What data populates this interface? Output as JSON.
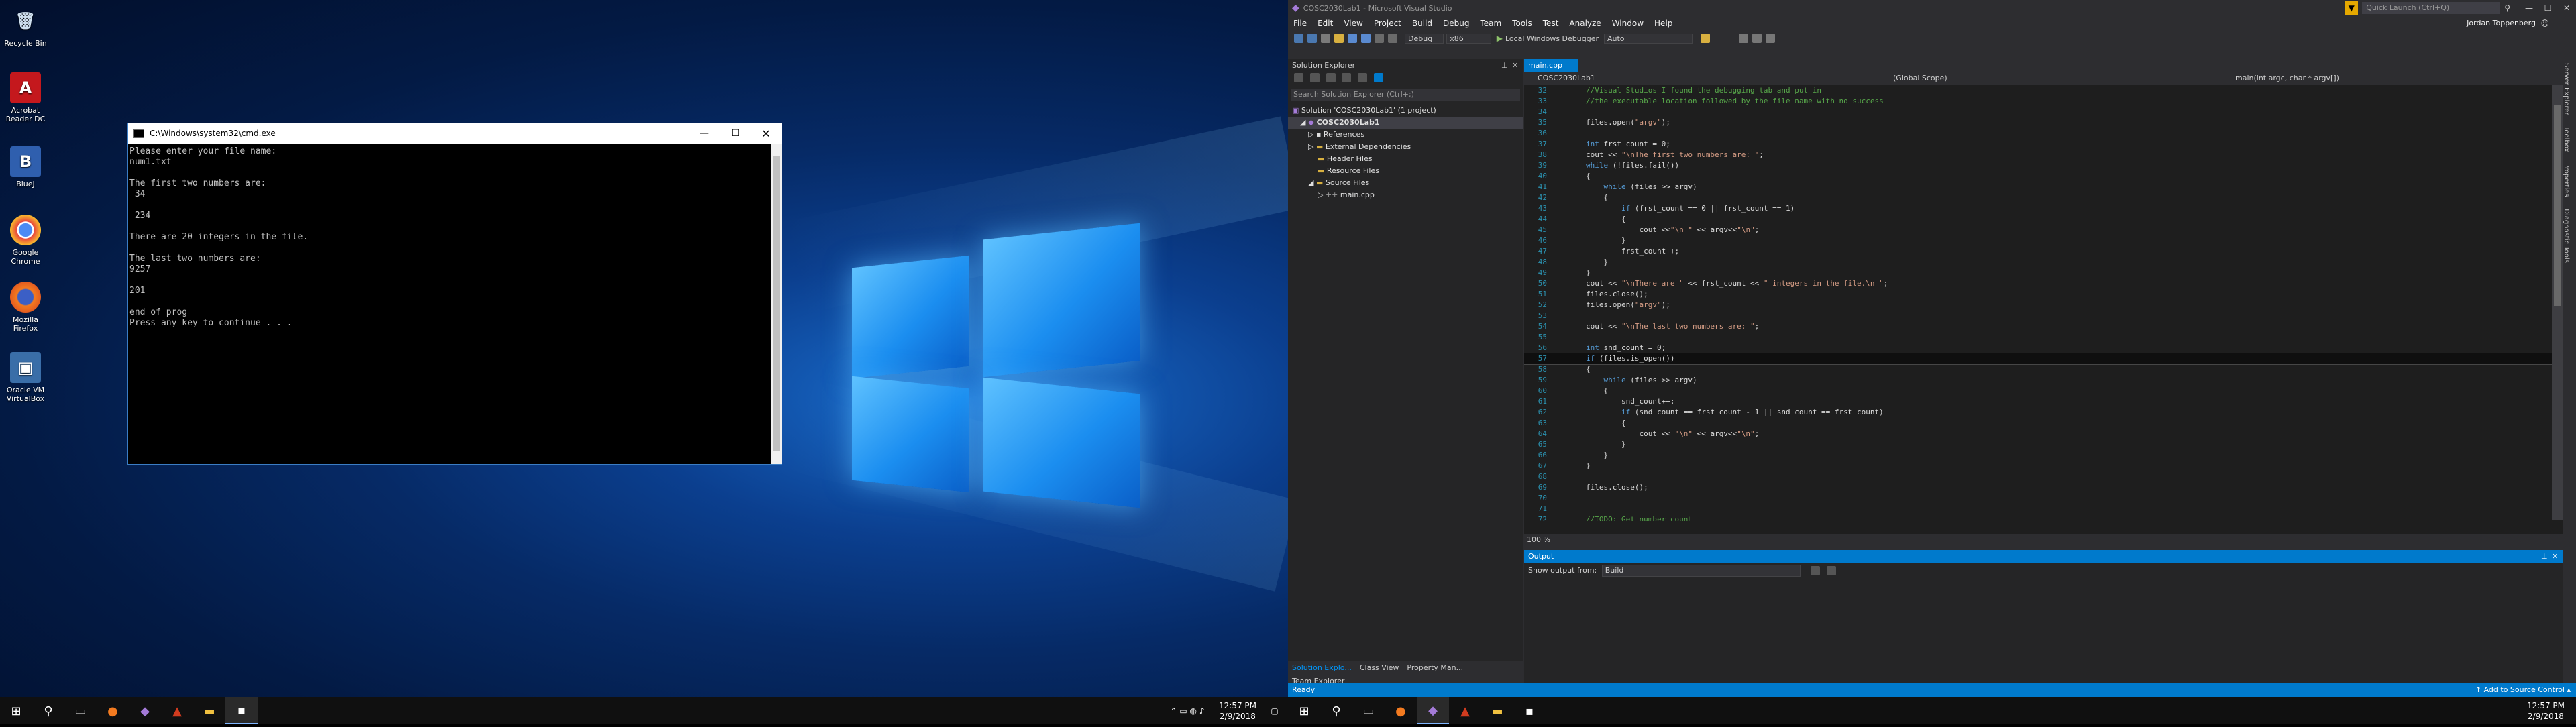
{
  "desktop_icons": [
    {
      "name": "recycle-bin",
      "label": "Recycle Bin",
      "glyph": "🗑",
      "color": "#8aa8c8"
    },
    {
      "name": "acrobat",
      "label": "Acrobat Reader DC",
      "glyph": "A",
      "color": "#c4181d"
    },
    {
      "name": "bluej",
      "label": "BlueJ",
      "glyph": "B",
      "color": "#2f5fae"
    },
    {
      "name": "chrome",
      "label": "Google Chrome",
      "glyph": "◉",
      "color": "#2d9c48"
    },
    {
      "name": "firefox",
      "label": "Mozilla Firefox",
      "glyph": "◍",
      "color": "#e66a1b"
    },
    {
      "name": "virtualbox",
      "label": "Oracle VM VirtualBox",
      "glyph": "▣",
      "color": "#3a6ea8"
    }
  ],
  "cmd": {
    "title": "C:\\Windows\\system32\\cmd.exe",
    "output": "Please enter your file name:\nnum1.txt\n\nThe first two numbers are:\n 34\n\n 234\n\nThere are 20 integers in the file.\n\nThe last two numbers are:\n9257\n\n201\n\nend of prog\nPress any key to continue . . ."
  },
  "taskbar1": {
    "time": "12:57 PM",
    "date": "2/9/2018"
  },
  "taskbar2": {
    "time": "12:57 PM",
    "date": "2/9/2018"
  },
  "vs": {
    "title": "COSC2030Lab1 - Microsoft Visual Studio",
    "quick_launch": "Quick Launch (Ctrl+Q)",
    "user": "Jordan Toppenberg",
    "menu": [
      "File",
      "Edit",
      "View",
      "Project",
      "Build",
      "Debug",
      "Team",
      "Tools",
      "Test",
      "Analyze",
      "Window",
      "Help"
    ],
    "toolbar": {
      "config": "Debug",
      "platform": "x86",
      "debugger": "Local Windows Debugger",
      "auto": "Auto"
    },
    "solution_explorer": {
      "title": "Solution Explorer",
      "search": "Search Solution Explorer (Ctrl+;)",
      "tree": [
        {
          "label": "Solution 'COSC2030Lab1' (1 project)",
          "indent": 0
        },
        {
          "label": "COSC2030Lab1",
          "indent": 1,
          "bold": true
        },
        {
          "label": "References",
          "indent": 2
        },
        {
          "label": "External Dependencies",
          "indent": 2
        },
        {
          "label": "Header Files",
          "indent": 2
        },
        {
          "label": "Resource Files",
          "indent": 2
        },
        {
          "label": "Source Files",
          "indent": 2
        },
        {
          "label": "main.cpp",
          "indent": 3
        }
      ],
      "bottom_tabs": [
        "Solution Explo...",
        "Class View",
        "Property Man...",
        "Team Explorer"
      ]
    },
    "editor": {
      "tab": "main.cpp",
      "nav_project": "COSC2030Lab1",
      "nav_scope": "(Global Scope)",
      "nav_func": "main(int argc, char * argv[])",
      "zoom": "100 %",
      "lines": [
        {
          "n": "32",
          "html": "<span class='cm'>//Visual Studios I found the debugging tab and put in</span>"
        },
        {
          "n": "33",
          "html": "<span class='cm'>//the executable location followed by the file name with no success</span>"
        },
        {
          "n": "34",
          "html": ""
        },
        {
          "n": "35",
          "html": "<span class='vr'>files.open(</span><span class='st'>\"argv\"</span><span class='vr'>);</span>"
        },
        {
          "n": "36",
          "html": ""
        },
        {
          "n": "37",
          "html": "<span class='kw'>int</span><span class='vr'> frst_count = 0;</span>"
        },
        {
          "n": "38",
          "html": "<span class='vr'>cout &lt;&lt; </span><span class='st'>\"\\nThe first two numbers are: \"</span><span class='vr'>;</span>"
        },
        {
          "n": "39",
          "html": "<span class='kw'>while</span><span class='vr'> (!files.fail())</span>"
        },
        {
          "n": "40",
          "html": "<span class='vr'>{</span>"
        },
        {
          "n": "41",
          "html": "<span class='vr'>    </span><span class='kw'>while</span><span class='vr'> (files &gt;&gt; argv)</span>"
        },
        {
          "n": "42",
          "html": "<span class='vr'>    {</span>"
        },
        {
          "n": "43",
          "html": "<span class='vr'>        </span><span class='kw'>if</span><span class='vr'> (frst_count == 0 || frst_count == 1)</span>"
        },
        {
          "n": "44",
          "html": "<span class='vr'>        {</span>"
        },
        {
          "n": "45",
          "html": "<span class='vr'>            cout &lt;&lt;</span><span class='st'>\"\\n \"</span><span class='vr'> &lt;&lt; argv&lt;&lt;</span><span class='st'>\"\\n\"</span><span class='vr'>;</span>"
        },
        {
          "n": "46",
          "html": "<span class='vr'>        }</span>"
        },
        {
          "n": "47",
          "html": "<span class='vr'>        frst_count++;</span>"
        },
        {
          "n": "48",
          "html": "<span class='vr'>    }</span>"
        },
        {
          "n": "49",
          "html": "<span class='vr'>}</span>"
        },
        {
          "n": "50",
          "html": "<span class='vr'>cout &lt;&lt; </span><span class='st'>\"\\nThere are \"</span><span class='vr'> &lt;&lt; frst_count &lt;&lt; </span><span class='st'>\" integers in the file.\\n \"</span><span class='vr'>;</span>"
        },
        {
          "n": "51",
          "html": "<span class='vr'>files.close();</span>"
        },
        {
          "n": "52",
          "html": "<span class='vr'>files.open(</span><span class='st'>\"argv\"</span><span class='vr'>);</span>"
        },
        {
          "n": "53",
          "html": ""
        },
        {
          "n": "54",
          "html": "<span class='vr'>cout &lt;&lt; </span><span class='st'>\"\\nThe last two numbers are: \"</span><span class='vr'>;</span>"
        },
        {
          "n": "55",
          "html": ""
        },
        {
          "n": "56",
          "html": "<span class='kw'>int</span><span class='vr'> snd_count = 0;</span>"
        },
        {
          "n": "57",
          "html": "<span class='kw'>if</span><span class='vr'> (files.is_open())</span>"
        },
        {
          "n": "58",
          "html": "<span class='vr'>{</span>"
        },
        {
          "n": "59",
          "html": "<span class='vr'>    </span><span class='kw'>while</span><span class='vr'> (files &gt;&gt; argv)</span>"
        },
        {
          "n": "60",
          "html": "<span class='vr'>    {</span>"
        },
        {
          "n": "61",
          "html": "<span class='vr'>        snd_count++;</span>"
        },
        {
          "n": "62",
          "html": "<span class='vr'>        </span><span class='kw'>if</span><span class='vr'> (snd_count == frst_count - 1 || snd_count == frst_count)</span>"
        },
        {
          "n": "63",
          "html": "<span class='vr'>        {</span>"
        },
        {
          "n": "64",
          "html": "<span class='vr'>            cout &lt;&lt; </span><span class='st'>\"\\n\"</span><span class='vr'> &lt;&lt; argv&lt;&lt;</span><span class='st'>\"\\n\"</span><span class='vr'>;</span>"
        },
        {
          "n": "65",
          "html": "<span class='vr'>        }</span>"
        },
        {
          "n": "66",
          "html": "<span class='vr'>    }</span>"
        },
        {
          "n": "67",
          "html": "<span class='vr'>}</span>"
        },
        {
          "n": "68",
          "html": ""
        },
        {
          "n": "69",
          "html": "<span class='vr'>files.close();</span>"
        },
        {
          "n": "70",
          "html": ""
        },
        {
          "n": "71",
          "html": ""
        },
        {
          "n": "72",
          "html": "<span class='cm'>//TODO: Get number count</span>"
        }
      ]
    },
    "output": {
      "title": "Output",
      "show_from_label": "Show output from:",
      "show_from_value": "Build"
    },
    "status": {
      "left": "Ready",
      "right": "↑ Add to Source Control ▴"
    },
    "right_rail": [
      "Server Explorer",
      "Toolbox",
      "Properties",
      "Diagnostic Tools"
    ]
  }
}
